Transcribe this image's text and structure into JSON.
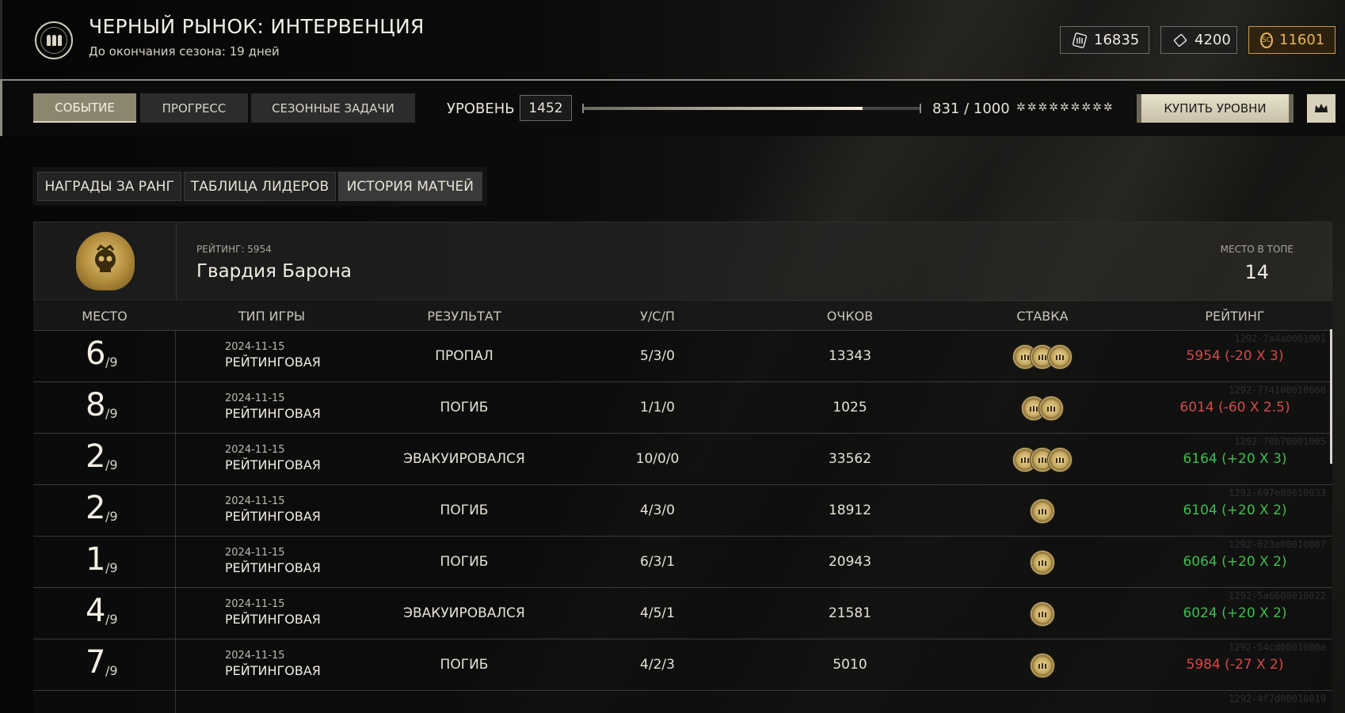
{
  "header": {
    "title": "ЧЕРНЫЙ РЫНОК: ИНТЕРВЕНЦИЯ",
    "subtitle": "До окончания сезона: 19 дней",
    "currencies": [
      {
        "icon": "ammo-card-icon",
        "value": "16835"
      },
      {
        "icon": "ticket-icon",
        "value": "4200"
      },
      {
        "icon": "sc-coin-icon",
        "value": "11601",
        "color": "#e6b45c"
      }
    ]
  },
  "nav": {
    "tabs": [
      {
        "label": "СОБЫТИЕ",
        "active": true
      },
      {
        "label": "ПРОГРЕСС",
        "active": false
      },
      {
        "label": "СЕЗОННЫЕ ЗАДАЧИ",
        "active": false
      }
    ],
    "level_label": "УРОВЕНЬ",
    "level_value": "1452",
    "progress_text": "831 / 1000",
    "progress_fraction": 0.831,
    "stars": "✲✲✲✲✲✲✲✲✲",
    "buy_label": "КУПИТЬ УРОВНИ",
    "crown_icon": "crown-icon"
  },
  "subtabs": [
    {
      "label": "НАГРАДЫ ЗА РАНГ",
      "active": false
    },
    {
      "label": "ТАБЛИЦА ЛИДЕРОВ",
      "active": false
    },
    {
      "label": "ИСТОРИЯ МАТЧЕЙ",
      "active": true
    }
  ],
  "team": {
    "rating_label": "РЕЙТИНГ: 5954",
    "name": "Гвардия Барона",
    "top_label": "МЕСТО В ТОПЕ",
    "top_value": "14",
    "emblem_icon": "skull-emblem-icon"
  },
  "table": {
    "headers": [
      "МЕСТО",
      "ТИП ИГРЫ",
      "РЕЗУЛЬТАТ",
      "У/С/П",
      "ОЧКОВ",
      "СТАВКА",
      "РЕЙТИНГ"
    ],
    "rows": [
      {
        "place": "6",
        "of": "/9",
        "date": "2024-11-15",
        "type": "РЕЙТИНГОВАЯ",
        "result": "ПРОПАЛ",
        "ksd": "5/3/0",
        "points": "13343",
        "stake": 3,
        "rating": "5954 (-20 X 3)",
        "rating_color": "#d7494a",
        "id": "1292-7a4a0001001"
      },
      {
        "place": "8",
        "of": "/9",
        "date": "2024-11-15",
        "type": "РЕЙТИНГОВАЯ",
        "result": "ПОГИБ",
        "ksd": "1/1/0",
        "points": "1025",
        "stake": 2,
        "rating": "6014 (-60 X 2.5)",
        "rating_color": "#d7494a",
        "id": "1292-774100010068"
      },
      {
        "place": "2",
        "of": "/9",
        "date": "2024-11-15",
        "type": "РЕЙТИНГОВАЯ",
        "result": "ЭВАКУИРОВАЛСЯ",
        "ksd": "10/0/0",
        "points": "33562",
        "stake": 3,
        "rating": "6164 (+20 X 3)",
        "rating_color": "#3fbe4c",
        "id": "1292-70b70001005"
      },
      {
        "place": "2",
        "of": "/9",
        "date": "2024-11-15",
        "type": "РЕЙТИНГОВАЯ",
        "result": "ПОГИБ",
        "ksd": "4/3/0",
        "points": "18912",
        "stake": 1,
        "rating": "6104 (+20 X 2)",
        "rating_color": "#3fbe4c",
        "id": "1292-697e00010033"
      },
      {
        "place": "1",
        "of": "/9",
        "date": "2024-11-15",
        "type": "РЕЙТИНГОВАЯ",
        "result": "ПОГИБ",
        "ksd": "6/3/1",
        "points": "20943",
        "stake": 1,
        "rating": "6064 (+20 X 2)",
        "rating_color": "#3fbe4c",
        "id": "1292-623e00010007"
      },
      {
        "place": "4",
        "of": "/9",
        "date": "2024-11-15",
        "type": "РЕЙТИНГОВАЯ",
        "result": "ЭВАКУИРОВАЛСЯ",
        "ksd": "4/5/1",
        "points": "21581",
        "stake": 1,
        "rating": "6024 (+20 X 2)",
        "rating_color": "#3fbe4c",
        "id": "1292-5a6600010022"
      },
      {
        "place": "7",
        "of": "/9",
        "date": "2024-11-15",
        "type": "РЕЙТИНГОВАЯ",
        "result": "ПОГИБ",
        "ksd": "4/2/3",
        "points": "5010",
        "stake": 1,
        "rating": "5984 (-27 X 2)",
        "rating_color": "#d7494a",
        "id": "1292-54cd0001000e"
      },
      {
        "place": "",
        "of": "",
        "date": "",
        "type": "",
        "result": "",
        "ksd": "",
        "points": "",
        "stake": 0,
        "rating": "",
        "rating_color": "#d7494a",
        "id": "1292-4f7d00010019"
      }
    ]
  }
}
